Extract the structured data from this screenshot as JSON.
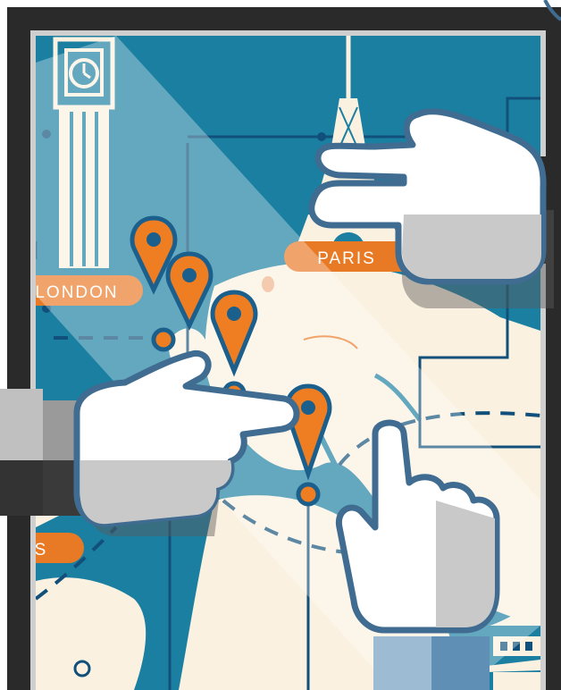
{
  "labels": {
    "paris": "PARIS",
    "london": "LONDON",
    "partial_left": "S"
  },
  "colors": {
    "frame": "#2a2a2a",
    "sea": "#1b7fa1",
    "land": "#fbf1e0",
    "line": "#11507a",
    "pin": "#ef7d22",
    "pin_outline": "#1b5f8c",
    "label_bg": "#e97a25",
    "hand_fill": "#ffffff",
    "hand_shadow": "#c9c9c9",
    "hand_outline": "#3f6c90",
    "sleeve": "#5f8fb4"
  },
  "icons": [
    "big-ben-icon",
    "eiffel-tower-icon",
    "pagoda-icon",
    "map-pin-icon",
    "pointing-hand-icon"
  ]
}
